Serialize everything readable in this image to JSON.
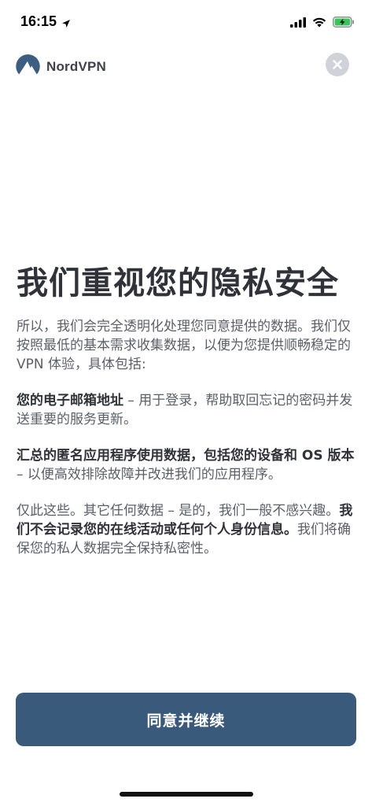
{
  "status_bar": {
    "time": "16:15",
    "icons": [
      "location-arrow-icon",
      "signal-icon",
      "wifi-icon",
      "battery-charging-icon"
    ]
  },
  "header": {
    "app_name": "NordVPN",
    "logo_icon": "nordvpn-mountain-icon",
    "close_icon": "close-icon"
  },
  "main": {
    "title": "我们重视您的隐私安全",
    "intro": "所以，我们会完全透明化处理您同意提供的数据。我们仅按照最低的基本需求收集数据，以便为您提供顺畅稳定的 VPN 体验，具体包括:",
    "email_bold": "您的电子邮箱地址",
    "email_rest": " – 用于登录，帮助取回忘记的密码并发送重要的服务更新。",
    "usage_bold": "汇总的匿名应用程序使用数据，包括您的设备和 OS 版本",
    "usage_rest": " – 以便高效排除故障并改进我们的应用程序。",
    "closing_start": "仅此这些。其它任何数据 – 是的，我们一般不感兴趣。",
    "closing_bold": "我们不会记录您的在线活动或任何个人身份信息。",
    "closing_end": "我们将确保您的私人数据完全保持私密性。"
  },
  "footer": {
    "continue_label": "同意并继续"
  },
  "colors": {
    "button_bg": "#3a5a7c",
    "title_text": "#2f3339",
    "body_text": "#5b6068",
    "close_bg": "#cfd3d9"
  }
}
